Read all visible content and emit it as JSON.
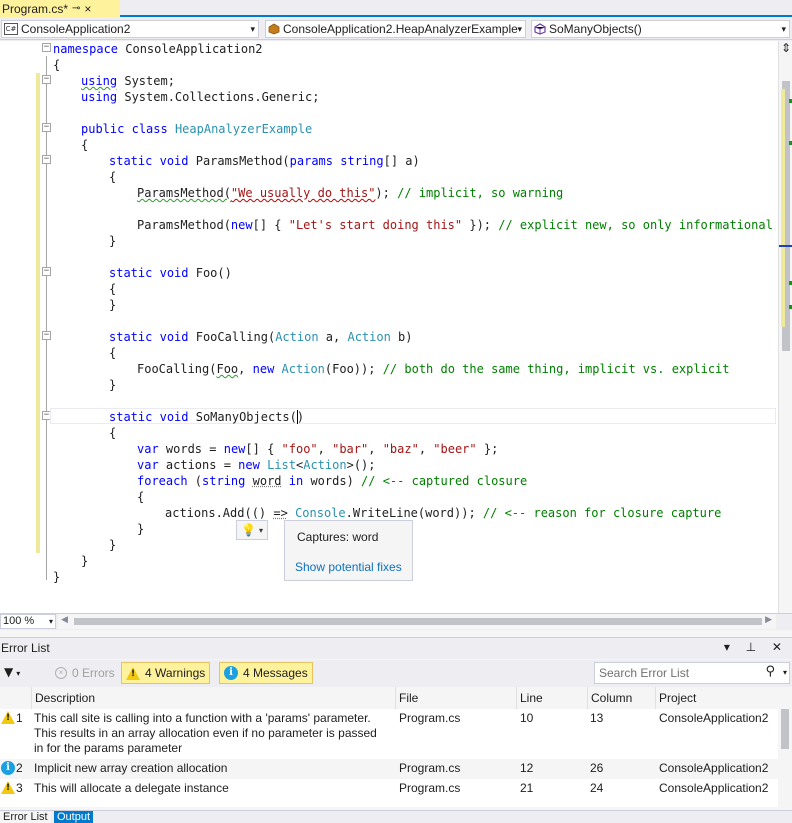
{
  "tab": {
    "title": "Program.cs*",
    "pin_icon": "pin-icon",
    "close_icon": "close-icon"
  },
  "navbar": {
    "project": "ConsoleApplication2",
    "type": "ConsoleApplication2.HeapAnalyzerExample",
    "member": "SoManyObjects()"
  },
  "code": {
    "l1": [
      "namespace",
      " ConsoleApplication2"
    ],
    "l2": "{",
    "l3": [
      "using",
      " System;"
    ],
    "l4": [
      "using",
      " System.Collections.Generic;"
    ],
    "l6": [
      "public",
      " ",
      "class",
      " ",
      "HeapAnalyzerExample"
    ],
    "l7": "{",
    "l8": [
      "static",
      " ",
      "void",
      " ParamsMethod(",
      "params",
      " ",
      "string",
      "[] a)"
    ],
    "l9": "{",
    "l10": [
      "ParamsMethod(",
      "\"We usually do this\"",
      ");",
      " // implicit, so warning"
    ],
    "l12": [
      "ParamsMethod(",
      "new",
      "[] { ",
      "\"Let's start doing this\"",
      " });",
      " // explicit new, so only informational"
    ],
    "l13": "}",
    "l15": [
      "static",
      " ",
      "void",
      " Foo()"
    ],
    "l16": "{",
    "l17": "}",
    "l19": [
      "static",
      " ",
      "void",
      " FooCalling(",
      "Action",
      " a, ",
      "Action",
      " b)"
    ],
    "l20": "{",
    "l21": [
      "FooCalling(",
      "Foo",
      ", ",
      "new",
      " ",
      "Action",
      "(Foo));",
      " // both do the same thing, implicit vs. explicit"
    ],
    "l22": "}",
    "l24": [
      "static",
      " ",
      "void",
      " SoManyObjects()"
    ],
    "l25": "{",
    "l26": [
      "var",
      " words = ",
      "new",
      "[] { ",
      "\"foo\"",
      ", ",
      "\"bar\"",
      ", ",
      "\"baz\"",
      ", ",
      "\"beer\"",
      " };"
    ],
    "l27": [
      "var",
      " actions = ",
      "new",
      " ",
      "List",
      "<",
      "Action",
      ">();"
    ],
    "l28": [
      "foreach",
      " (",
      "string",
      " ",
      "word",
      " ",
      "in",
      " words)",
      " // <-- captured closure"
    ],
    "l29": "{",
    "l30": [
      "actions.Add(() ",
      "=>",
      " ",
      "Console",
      ".WriteLine(word));",
      " // <-- reason for closure capture"
    ],
    "l31": "}",
    "l32": "}",
    "l33": "}",
    "l34": "}"
  },
  "quickinfo": {
    "captures": "Captures: word",
    "fixes": "Show potential fixes"
  },
  "zoom": "100 %",
  "error_list": {
    "title": "Error List",
    "panel_controls": "▾ ⊥ ✕",
    "errors": "0 Errors",
    "warnings": "4 Warnings",
    "messages": "4 Messages",
    "search_placeholder": "Search Error List",
    "columns": [
      "Description",
      "File",
      "Line",
      "Column",
      "Project"
    ],
    "rows": [
      {
        "kind": "warning",
        "num": "1",
        "desc": "This call site is calling into a function with a 'params' parameter. This results in an array allocation even if no parameter is passed in for the params parameter",
        "file": "Program.cs",
        "line": "10",
        "col": "13",
        "project": "ConsoleApplication2"
      },
      {
        "kind": "info",
        "num": "2",
        "desc": "Implicit new array creation allocation",
        "file": "Program.cs",
        "line": "12",
        "col": "26",
        "project": "ConsoleApplication2"
      },
      {
        "kind": "warning",
        "num": "3",
        "desc": "This will allocate a delegate instance",
        "file": "Program.cs",
        "line": "21",
        "col": "24",
        "project": "ConsoleApplication2"
      }
    ]
  },
  "bottom_tabs": {
    "error_list": "Error List",
    "output": "Output"
  }
}
